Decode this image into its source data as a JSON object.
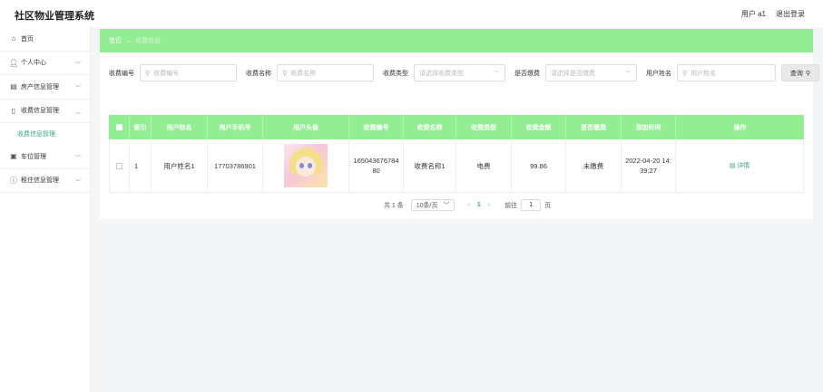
{
  "header": {
    "title": "社区物业管理系统",
    "user_label": "用户 a1",
    "logout_label": "退出登录"
  },
  "sidebar": {
    "items": [
      {
        "label": "首页",
        "icon": "home-icon"
      },
      {
        "label": "个人中心",
        "icon": "user-icon"
      },
      {
        "label": "房产信息管理",
        "icon": "building-icon"
      },
      {
        "label": "收费信息管理",
        "icon": "phone-icon"
      },
      {
        "label": "车位管理",
        "icon": "parking-icon"
      },
      {
        "label": "租住信息管理",
        "icon": "info-icon"
      }
    ],
    "submenu": {
      "label": "收费信息管理"
    }
  },
  "breadcrumb": {
    "home": "首页",
    "arrow": "→",
    "current": "收费信息"
  },
  "search": {
    "fee_no_label": "收费编号",
    "fee_no_placeholder": "收费编号",
    "fee_name_label": "收费名称",
    "fee_name_placeholder": "收费名称",
    "fee_type_label": "收费类型",
    "fee_type_placeholder": "请选择收费类型",
    "paid_label": "是否缴费",
    "paid_placeholder": "请选择是否缴费",
    "username_label": "用户姓名",
    "username_placeholder": "用户姓名",
    "query_label": "查询"
  },
  "table": {
    "headers": [
      "索引",
      "用户姓名",
      "用户手机号",
      "用户头像",
      "收费编号",
      "收费名称",
      "收费类型",
      "收费金额",
      "是否缴费",
      "添加时间",
      "操作"
    ],
    "rows": [
      {
        "index": "1",
        "username": "用户姓名1",
        "phone": "17703786901",
        "fee_no": "165043676784 80",
        "fee_name": "收费名称1",
        "fee_type": "电费",
        "amount": "99.86",
        "paid": "未缴费",
        "created": "2022-04-20 14: 39:27",
        "action": "详情"
      }
    ]
  },
  "pagination": {
    "total": "共 1 条",
    "page_size": "10条/页",
    "current_page": "1",
    "goto_label": "前往",
    "goto_value": "1",
    "page_unit": "页"
  },
  "colors": {
    "accent": "#93ee93",
    "link": "#3aa680"
  }
}
